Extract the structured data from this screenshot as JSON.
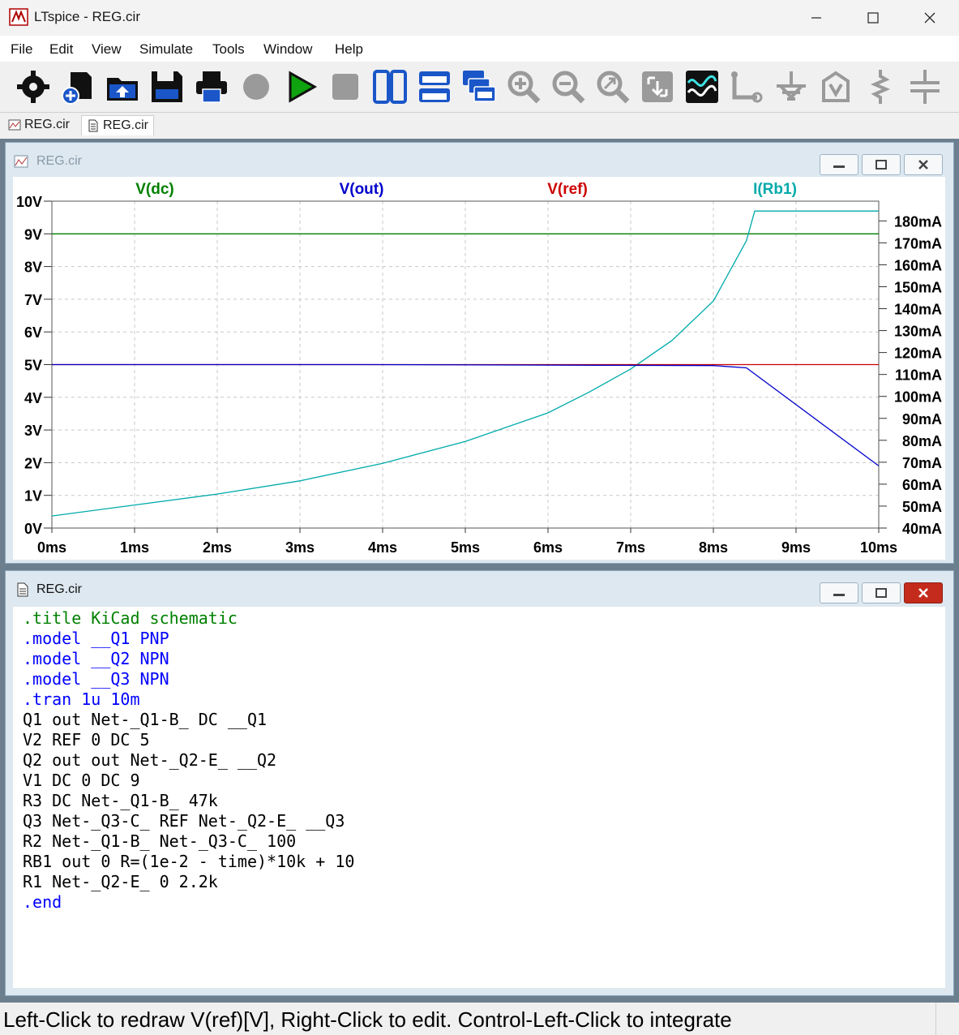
{
  "window": {
    "title": "LTspice - REG.cir"
  },
  "menu": [
    "File",
    "Edit",
    "View",
    "Simulate",
    "Tools",
    "Window",
    "Help"
  ],
  "toolbar": [
    "settings-icon",
    "new-schematic-icon",
    "open-icon",
    "save-icon",
    "print-icon",
    "halt-icon",
    "run-icon",
    "stop-icon",
    "tile-vertical-icon",
    "tile-horizontal-icon",
    "cascade-icon",
    "zoom-in-icon",
    "zoom-out-icon",
    "zoom-fit-icon",
    "autorange-icon",
    "waveform-icon",
    "wire-icon",
    "ground-icon",
    "label-icon",
    "resistor-icon",
    "capacitor-icon"
  ],
  "tabs": [
    {
      "label": "REG.cir",
      "icon": "waveform-tab-icon"
    },
    {
      "label": "REG.cir",
      "icon": "netlist-tab-icon"
    }
  ],
  "plot_window": {
    "title": "REG.cir"
  },
  "netlist_window": {
    "title": "REG.cir"
  },
  "chart_data": {
    "type": "line",
    "x_ticks": [
      "0ms",
      "1ms",
      "2ms",
      "3ms",
      "4ms",
      "5ms",
      "6ms",
      "7ms",
      "8ms",
      "9ms",
      "10ms"
    ],
    "xlim_ms": [
      0,
      10
    ],
    "y_left_ticks": [
      "0V",
      "1V",
      "2V",
      "3V",
      "4V",
      "5V",
      "6V",
      "7V",
      "8V",
      "9V",
      "10V"
    ],
    "ylim_left_V": [
      0,
      10
    ],
    "y_right_ticks": [
      "40mA",
      "50mA",
      "60mA",
      "70mA",
      "80mA",
      "90mA",
      "100mA",
      "110mA",
      "120mA",
      "130mA",
      "140mA",
      "150mA",
      "160mA",
      "170mA",
      "180mA"
    ],
    "ylim_right_mA": [
      40,
      189
    ],
    "grid": true,
    "series": [
      {
        "name": "V(dc)",
        "color": "#008000",
        "axis": "left",
        "x": [
          0,
          10
        ],
        "y": [
          9,
          9
        ]
      },
      {
        "name": "V(out)",
        "color": "#0000cc",
        "axis": "left",
        "x": [
          0,
          3.8,
          6.6,
          8.0,
          8.4,
          10.0
        ],
        "y": [
          5,
          5,
          4.98,
          4.97,
          4.9,
          1.9
        ]
      },
      {
        "name": "V(ref)",
        "color": "#cc0000",
        "axis": "left",
        "x": [
          0,
          10
        ],
        "y": [
          5,
          5
        ]
      },
      {
        "name": "I(Rb1)",
        "color": "#00aaaa",
        "axis": "right",
        "x": [
          0,
          1,
          2,
          3,
          4,
          5,
          6,
          6.5,
          7,
          7.5,
          8,
          8.4,
          8.5,
          10
        ],
        "y": [
          45.5,
          50.5,
          55.5,
          61.5,
          69.5,
          79.5,
          92.5,
          102,
          112.5,
          125.5,
          143.5,
          171,
          184.5,
          184.5
        ]
      }
    ]
  },
  "netlist": [
    {
      "text": ".title KiCad schematic",
      "color": "#008000"
    },
    {
      "text": ".model __Q1 PNP",
      "color": "#0000ff"
    },
    {
      "text": ".model __Q2 NPN",
      "color": "#0000ff"
    },
    {
      "text": ".model __Q3 NPN",
      "color": "#0000ff"
    },
    {
      "text": ".tran 1u 10m",
      "color": "#0000ff"
    },
    {
      "text": "Q1 out Net-_Q1-B_ DC __Q1",
      "color": "#000000"
    },
    {
      "text": "V2 REF 0 DC 5",
      "color": "#000000"
    },
    {
      "text": "Q2 out out Net-_Q2-E_ __Q2",
      "color": "#000000"
    },
    {
      "text": "V1 DC 0 DC 9",
      "color": "#000000"
    },
    {
      "text": "R3 DC Net-_Q1-B_ 47k",
      "color": "#000000"
    },
    {
      "text": "Q3 Net-_Q3-C_ REF Net-_Q2-E_ __Q3",
      "color": "#000000"
    },
    {
      "text": "R2 Net-_Q1-B_ Net-_Q3-C_ 100",
      "color": "#000000"
    },
    {
      "text": "RB1 out 0 R=(1e-2 - time)*10k + 10",
      "color": "#000000"
    },
    {
      "text": "R1 Net-_Q2-E_ 0 2.2k",
      "color": "#000000"
    },
    {
      "text": ".end",
      "color": "#0000ff"
    }
  ],
  "status": "Left-Click to redraw V(ref)[V],  Right-Click to edit. Control-Left-Click to integrate"
}
